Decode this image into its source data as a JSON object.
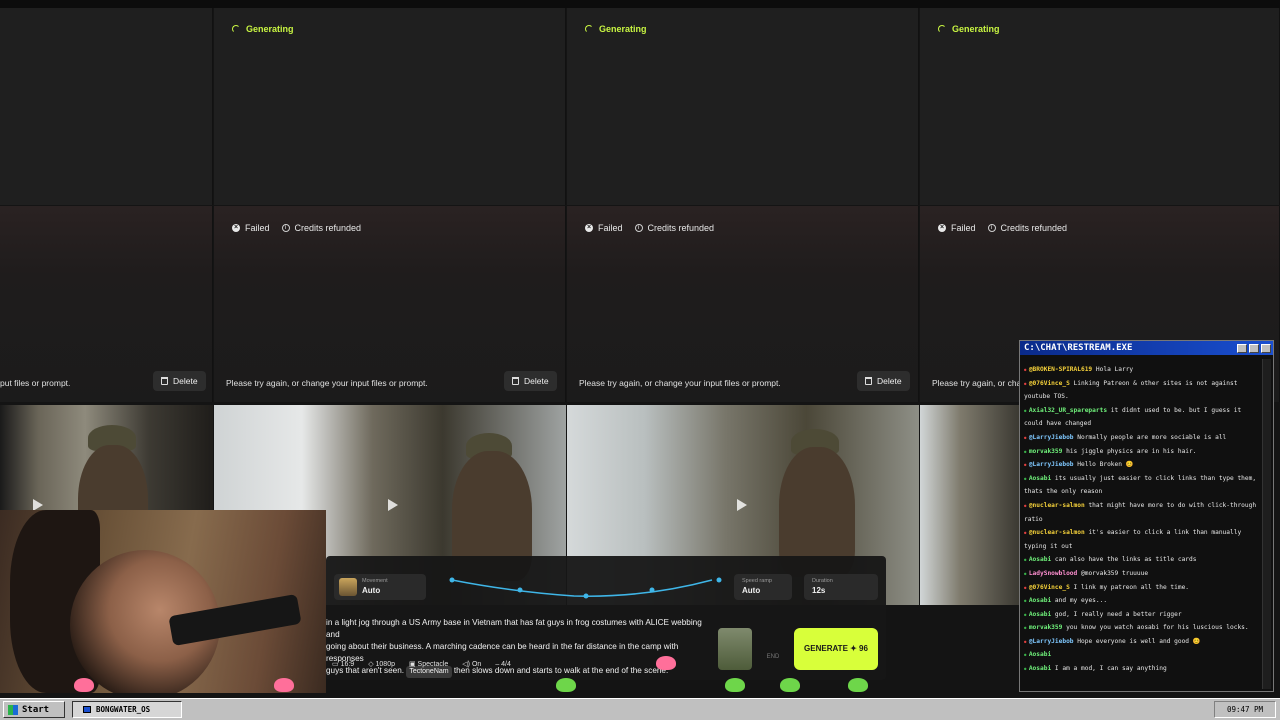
{
  "generating": {
    "status": "Generating",
    "cards": [
      {
        "id": "gen-1"
      },
      {
        "id": "gen-2"
      },
      {
        "id": "gen-3"
      }
    ]
  },
  "failed": {
    "status": "Failed",
    "credits": "Credits refunded",
    "message": "Please try again, or change your input files or prompt.",
    "partial_message_left": "put files or prompt.",
    "partial_message_right": "Please try again, or chan",
    "delete_label": "Delete"
  },
  "prompt_bar": {
    "movement_label": "Movement",
    "movement_value": "Auto",
    "speed_ramp_label": "Speed ramp",
    "speed_ramp_value": "Auto",
    "duration_label": "Duration",
    "duration_value": "12s",
    "prompt_line1": "in a light jog through a US Army base in Vietnam that has fat guys in frog costumes with ALICE webbing and",
    "prompt_line2": "going about their business. A marching cadence can be heard in the far distance in the camp with responses",
    "prompt_line3a": "guys that aren't seen.",
    "prompt_chip": "TectoneNam",
    "prompt_line3b": "then slows down and starts to walk at the end of the scene.",
    "aspect": "16:9",
    "resolution": "1080p",
    "style": "Spectacle",
    "audio": "On",
    "count": "4/4",
    "end_label": "END",
    "generate_label": "GENERATE ✦ 96"
  },
  "chat": {
    "title": "C:\\CHAT\\RESTREAM.EXE",
    "messages": [
      {
        "user": "@BROKEN-SPIRAL619",
        "text": "Hola Larry",
        "color": "#f5d13a",
        "dot": "#e04040"
      },
      {
        "user": "@076Vince_S",
        "text": "Linking Patreon & other sites is not against youtube TOS.",
        "color": "#f5d13a",
        "dot": "#e04040"
      },
      {
        "user": "Axial32_UR_spareparts",
        "text": "it didnt used to be. but I guess it could have changed",
        "color": "#6ff07a",
        "dot": "#3ab04a"
      },
      {
        "user": "@LarryJiebob",
        "text": "Normally people are more sociable is all",
        "color": "#7fc8ff",
        "dot": "#e04040"
      },
      {
        "user": "morvak359",
        "text": "his jiggle physics are in his hair.",
        "color": "#6ff07a",
        "dot": "#3ab04a"
      },
      {
        "user": "@LarryJiebob",
        "text": "Hello Broken 😊",
        "color": "#7fc8ff",
        "dot": "#e04040"
      },
      {
        "user": "Aosabi",
        "text": "its usually just easier to click links than type them, thats the only reason",
        "color": "#6ff07a",
        "dot": "#3ab04a"
      },
      {
        "user": "@nuclear-salmon",
        "text": "that might have more to do with click-through ratio",
        "color": "#f5d13a",
        "dot": "#e04040"
      },
      {
        "user": "@nuclear-salmon",
        "text": "it's easier to click a link than manually typing it out",
        "color": "#f5d13a",
        "dot": "#e04040"
      },
      {
        "user": "Aosabi",
        "text": "can also have the links as title cards",
        "color": "#6ff07a",
        "dot": "#3ab04a"
      },
      {
        "user": "LadySnowblood",
        "text": "@morvak359 truuuue",
        "color": "#ff8fd0",
        "dot": "#3ab04a"
      },
      {
        "user": "@076Vince_S",
        "text": "I link my patreon all the time.",
        "color": "#f5d13a",
        "dot": "#e04040"
      },
      {
        "user": "Aosabi",
        "text": "and my eyes...",
        "color": "#6ff07a",
        "dot": "#3ab04a"
      },
      {
        "user": "Aosabi",
        "text": "god, I really need a better rigger",
        "color": "#6ff07a",
        "dot": "#3ab04a"
      },
      {
        "user": "morvak359",
        "text": "you know you watch aosabi for his luscious locks.",
        "color": "#6ff07a",
        "dot": "#3ab04a"
      },
      {
        "user": "@LarryJiebob",
        "text": "Hope everyone is well and good 😊",
        "color": "#7fc8ff",
        "dot": "#e04040"
      },
      {
        "user": "Aosabi",
        "text": "",
        "color": "#6ff07a",
        "dot": "#3ab04a"
      },
      {
        "user": "Aosabi",
        "text": "I am a mod, I can say anything",
        "color": "#6ff07a",
        "dot": "#3ab04a"
      }
    ]
  },
  "taskbar": {
    "start_label": "Start",
    "task_label": "BONGWATER_OS",
    "clock": "09:47 PM"
  }
}
